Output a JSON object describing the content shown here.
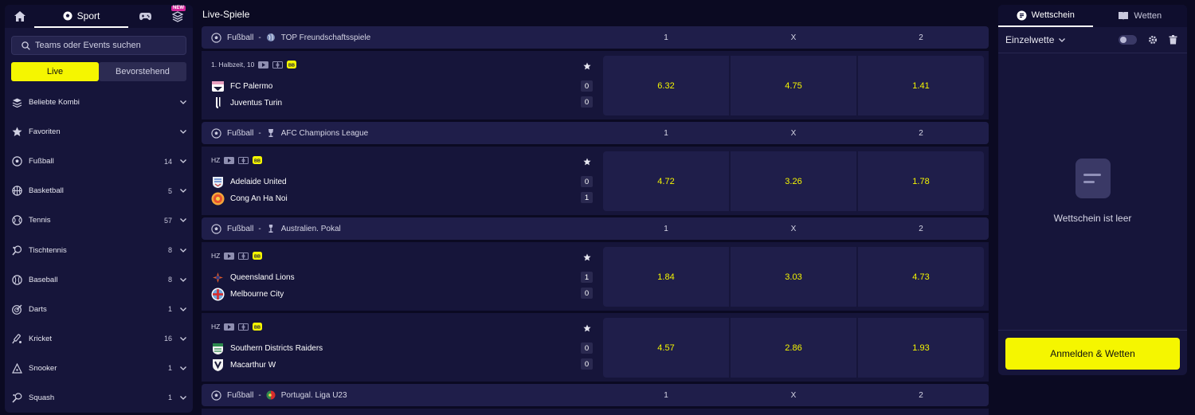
{
  "nav": {
    "sport_label": "Sport",
    "new_badge": "NEW"
  },
  "search": {
    "placeholder": "Teams oder Events suchen"
  },
  "toggle": {
    "live": "Live",
    "upcoming": "Bevorstehend"
  },
  "sports": [
    {
      "label": "Beliebte Kombi",
      "count": "",
      "icon": "layers-icon"
    },
    {
      "label": "Favoriten",
      "count": "",
      "icon": "star-icon"
    },
    {
      "label": "Fußball",
      "count": "14",
      "icon": "soccer-ball-icon"
    },
    {
      "label": "Basketball",
      "count": "5",
      "icon": "basketball-icon"
    },
    {
      "label": "Tennis",
      "count": "57",
      "icon": "tennis-ball-icon"
    },
    {
      "label": "Tischtennis",
      "count": "8",
      "icon": "table-tennis-icon"
    },
    {
      "label": "Baseball",
      "count": "8",
      "icon": "baseball-icon"
    },
    {
      "label": "Darts",
      "count": "1",
      "icon": "darts-icon"
    },
    {
      "label": "Kricket",
      "count": "16",
      "icon": "cricket-icon"
    },
    {
      "label": "Snooker",
      "count": "1",
      "icon": "snooker-icon"
    },
    {
      "label": "Squash",
      "count": "1",
      "icon": "squash-icon"
    }
  ],
  "main": {
    "title": "Live-Spiele",
    "col_labels": {
      "home": "1",
      "draw": "X",
      "away": "2"
    },
    "leagues": [
      {
        "sport": "Fußball",
        "sep": "-",
        "name": "TOP Freundschaftsspiele"
      },
      {
        "sport": "Fußball",
        "sep": "-",
        "name": "AFC Champions League"
      },
      {
        "sport": "Fußball",
        "sep": "-",
        "name": "Australien. Pokal"
      },
      {
        "sport": "Fußball",
        "sep": "-",
        "name": "Portugal. Liga U23"
      }
    ],
    "matches": [
      {
        "status": "1. Halbzeit, 10",
        "home": "FC Palermo",
        "away": "Juventus Turin",
        "home_score": "0",
        "away_score": "0",
        "odds": [
          "6.32",
          "4.75",
          "1.41"
        ]
      },
      {
        "status": "HZ",
        "home": "Adelaide United",
        "away": "Cong An Ha Noi",
        "home_score": "0",
        "away_score": "1",
        "odds": [
          "4.72",
          "3.26",
          "1.78"
        ]
      },
      {
        "status": "HZ",
        "home": "Queensland Lions",
        "away": "Melbourne City",
        "home_score": "1",
        "away_score": "0",
        "odds": [
          "1.84",
          "3.03",
          "4.73"
        ]
      },
      {
        "status": "HZ",
        "home": "Southern Districts Raiders",
        "away": "Macarthur W",
        "home_score": "0",
        "away_score": "0",
        "odds": [
          "4.57",
          "2.86",
          "1.93"
        ]
      }
    ]
  },
  "betslip": {
    "tab_slip": "Wettschein",
    "tab_bets": "Wetten",
    "mode": "Einzelwette",
    "empty_text": "Wettschein ist leer",
    "login_button": "Anmelden & Wetten"
  },
  "colors": {
    "accent": "#f5f600",
    "bg": "#0b0a22",
    "panel": "#16153a",
    "header": "#1f1e4a"
  }
}
